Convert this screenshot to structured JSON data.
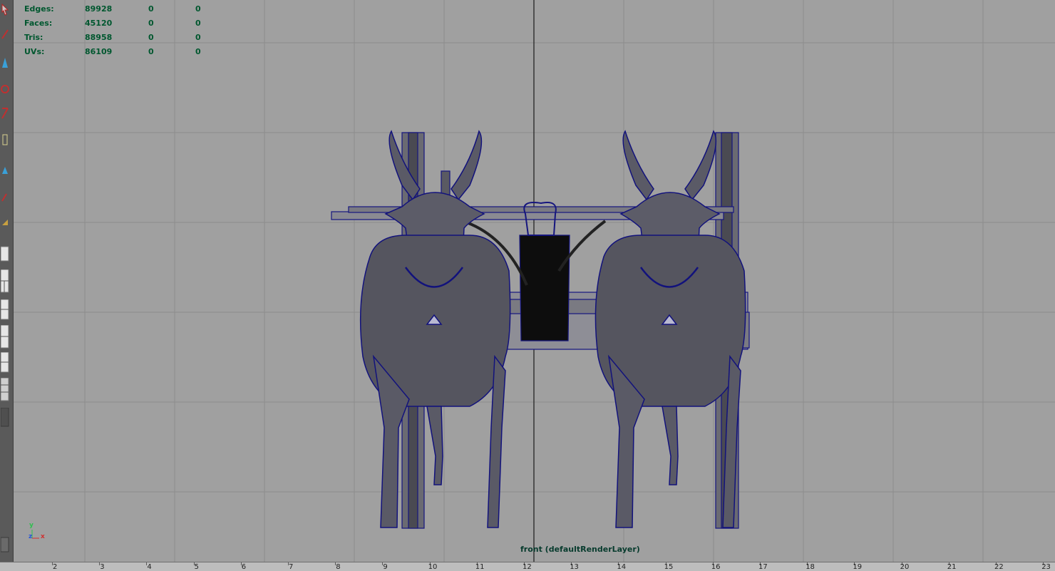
{
  "hud": {
    "rows": [
      {
        "label": "Edges:",
        "total": "89928",
        "selected": "0",
        "triangles": "0"
      },
      {
        "label": "Faces:",
        "total": "45120",
        "selected": "0",
        "triangles": "0"
      },
      {
        "label": "Tris:",
        "total": "88958",
        "selected": "0",
        "triangles": "0"
      },
      {
        "label": "UVs:",
        "total": "86109",
        "selected": "0",
        "triangles": "0"
      }
    ]
  },
  "viewport": {
    "camera_label": "front (defaultRenderLayer)",
    "axis": {
      "y": "y",
      "z": "z",
      "x": "x"
    }
  },
  "timeline": {
    "ticks": [
      "2",
      "3",
      "4",
      "5",
      "6",
      "7",
      "8",
      "9",
      "10",
      "11",
      "12",
      "13",
      "14",
      "15",
      "16",
      "17",
      "18",
      "19",
      "20",
      "21",
      "22",
      "23"
    ]
  },
  "toolbox": {
    "tools": [
      "select-tool-icon",
      "lasso-tool-icon",
      "paint-select-icon",
      "move-tool-icon",
      "rotate-tool-icon",
      "scale-tool-icon",
      "manipulator-icon",
      "soft-mod-icon",
      "show-manip-icon",
      "last-tool-icon",
      "single-view-layout-icon",
      "four-view-layout-icon",
      "persp-outliner-layout-icon",
      "persp-graph-layout-icon",
      "hypershade-layout-icon",
      "persp-uv-layout-icon",
      "outliner-layout-icon"
    ]
  },
  "colors": {
    "viewport_bg": "#a0a0a0",
    "grid_line": "#8c8c8c",
    "hud_text": "#00572f",
    "wireframe": "#10107a",
    "mesh_fill": "#5a5a66"
  }
}
